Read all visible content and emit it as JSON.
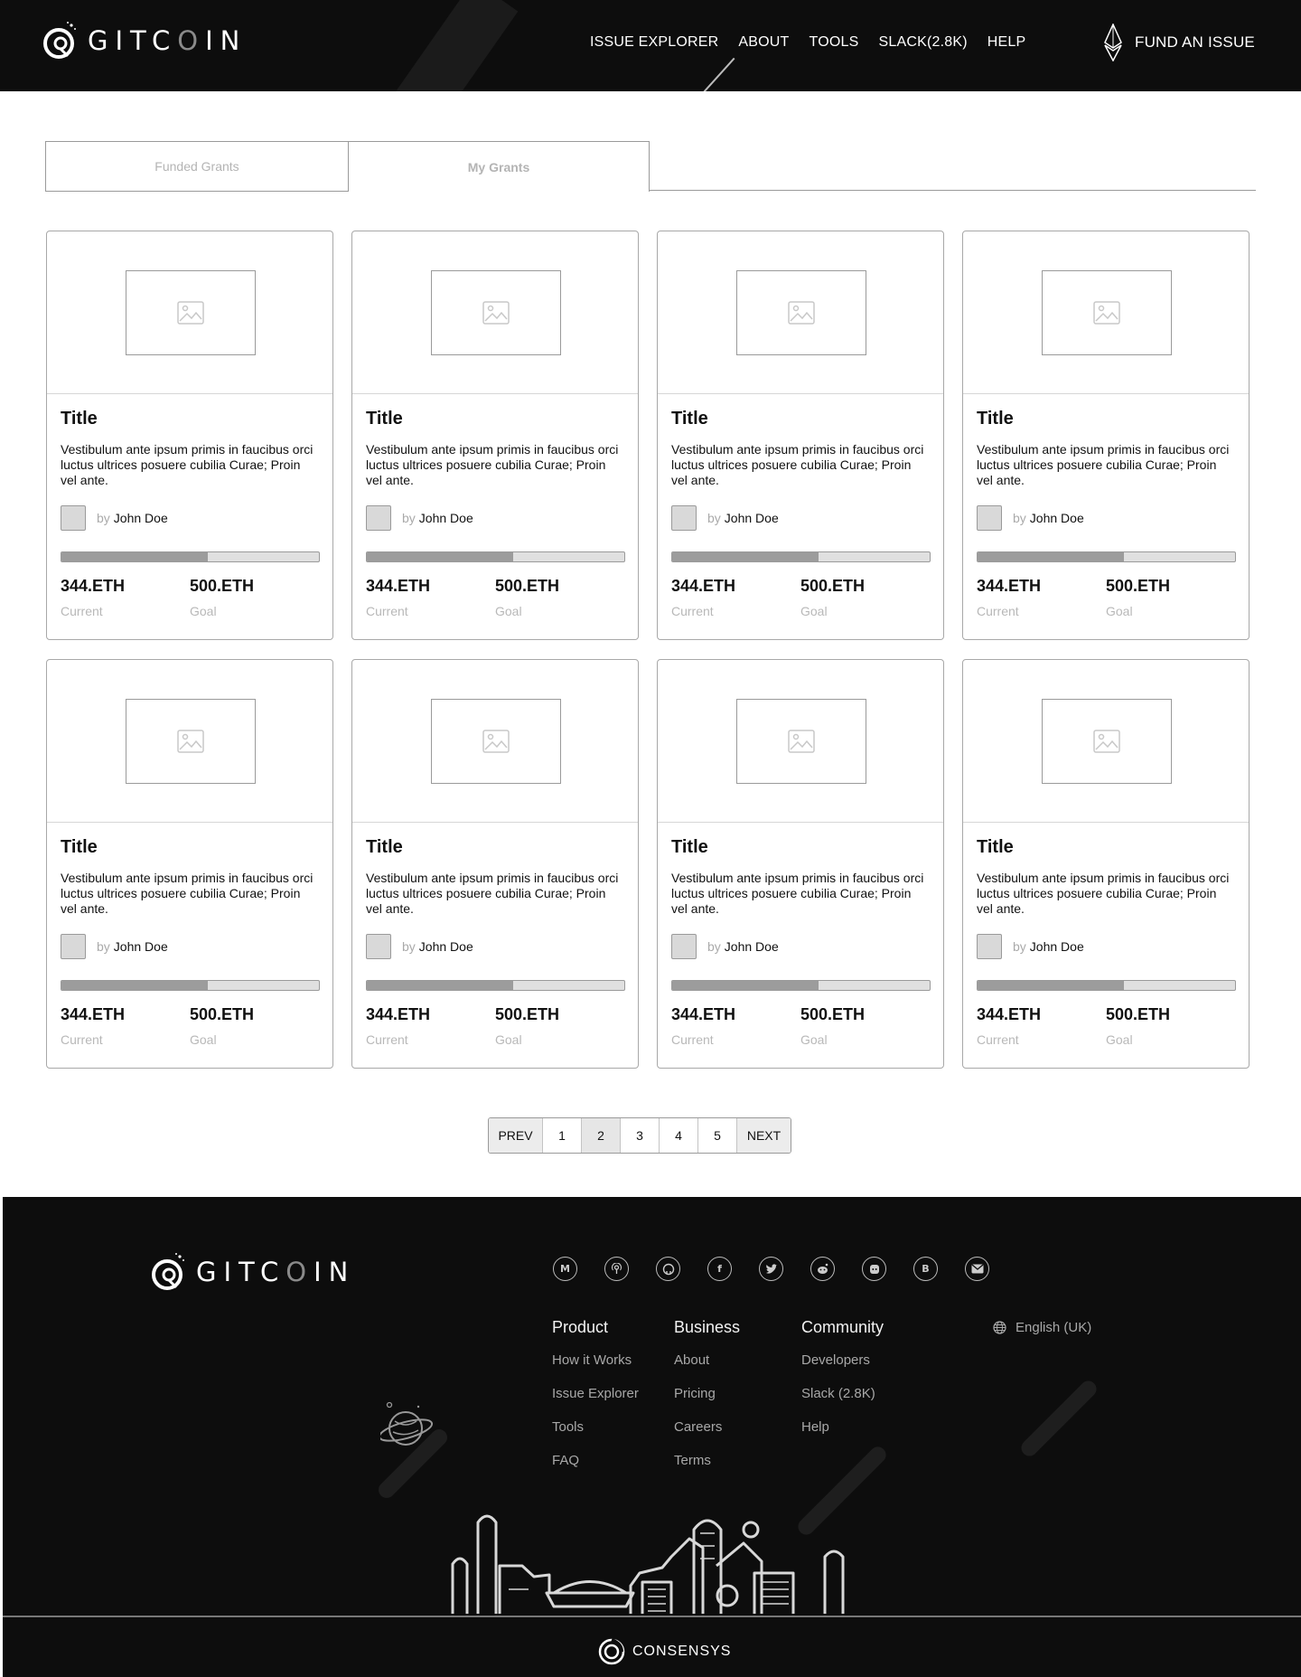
{
  "header": {
    "logo_text": "GITCOIN",
    "nav": [
      "ISSUE EXPLORER",
      "ABOUT",
      "TOOLS",
      "SLACK(2.8K)",
      "HELP"
    ],
    "fund_label": "FUND AN ISSUE"
  },
  "tabs": [
    "Funded Grants",
    "My Grants"
  ],
  "cards": [
    {
      "title": "Title",
      "description": "Vestibulum ante ipsum primis in faucibus orci luctus  ultrices posuere cubilia Curae; Proin vel ante.",
      "by": "by",
      "author": "John Doe",
      "progress": 0.57,
      "current": "344.ETH",
      "current_label": "Current",
      "goal": "500.ETH",
      "goal_label": "Goal"
    },
    {
      "title": "Title",
      "description": "Vestibulum ante ipsum primis in faucibus orci luctus  ultrices posuere cubilia Curae; Proin vel ante.",
      "by": "by",
      "author": "John Doe",
      "progress": 0.57,
      "current": "344.ETH",
      "current_label": "Current",
      "goal": "500.ETH",
      "goal_label": "Goal"
    },
    {
      "title": "Title",
      "description": "Vestibulum ante ipsum primis in faucibus orci luctus  ultrices posuere cubilia Curae; Proin vel ante.",
      "by": "by",
      "author": "John Doe",
      "progress": 0.57,
      "current": "344.ETH",
      "current_label": "Current",
      "goal": "500.ETH",
      "goal_label": "Goal"
    },
    {
      "title": "Title",
      "description": "Vestibulum ante ipsum primis in faucibus orci luctus  ultrices posuere cubilia Curae; Proin vel ante.",
      "by": "by",
      "author": "John Doe",
      "progress": 0.57,
      "current": "344.ETH",
      "current_label": "Current",
      "goal": "500.ETH",
      "goal_label": "Goal"
    },
    {
      "title": "Title",
      "description": "Vestibulum ante ipsum primis in faucibus orci luctus  ultrices posuere cubilia Curae; Proin vel ante.",
      "by": "by",
      "author": "John Doe",
      "progress": 0.57,
      "current": "344.ETH",
      "current_label": "Current",
      "goal": "500.ETH",
      "goal_label": "Goal"
    },
    {
      "title": "Title",
      "description": "Vestibulum ante ipsum primis in faucibus orci luctus  ultrices posuere cubilia Curae; Proin vel ante.",
      "by": "by",
      "author": "John Doe",
      "progress": 0.57,
      "current": "344.ETH",
      "current_label": "Current",
      "goal": "500.ETH",
      "goal_label": "Goal"
    },
    {
      "title": "Title",
      "description": "Vestibulum ante ipsum primis in faucibus orci luctus  ultrices posuere cubilia Curae; Proin vel ante.",
      "by": "by",
      "author": "John Doe",
      "progress": 0.57,
      "current": "344.ETH",
      "current_label": "Current",
      "goal": "500.ETH",
      "goal_label": "Goal"
    },
    {
      "title": "Title",
      "description": "Vestibulum ante ipsum primis in faucibus orci luctus  ultrices posuere cubilia Curae; Proin vel ante.",
      "by": "by",
      "author": "John Doe",
      "progress": 0.57,
      "current": "344.ETH",
      "current_label": "Current",
      "goal": "500.ETH",
      "goal_label": "Goal"
    }
  ],
  "pagination": {
    "prev": "PREV",
    "pages": [
      "1",
      "2",
      "3",
      "4",
      "5"
    ],
    "active_page": "2",
    "next": "NEXT"
  },
  "footer": {
    "logo_text": "GITCOIN",
    "social_icons": [
      "medium-icon",
      "podcast-icon",
      "github-icon",
      "facebook-icon",
      "twitter-icon",
      "reddit-icon",
      "discord-icon",
      "bitcoin-icon",
      "email-icon"
    ],
    "columns": [
      {
        "heading": "Product",
        "links": [
          "How it Works",
          "Issue Explorer",
          "Tools",
          "FAQ"
        ]
      },
      {
        "heading": "Business",
        "links": [
          "About",
          "Pricing",
          "Careers",
          "Terms"
        ]
      },
      {
        "heading": "Community",
        "links": [
          "Developers",
          "Slack (2.8K)",
          "Help"
        ]
      }
    ],
    "language": "English (UK)",
    "brand": "CONSENSYS"
  },
  "colors": {
    "header_bg": "#0d0d0d",
    "footer_bg": "#0d0d0d",
    "progress_fill": "#9c9c9c",
    "progress_track": "#e0e0e0"
  }
}
